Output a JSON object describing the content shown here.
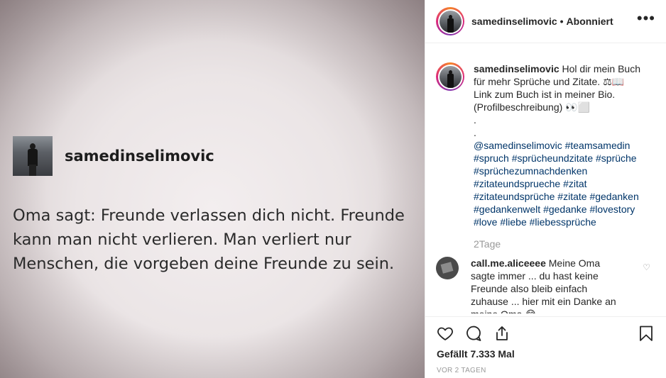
{
  "image": {
    "quote_username": "samedinselimovic",
    "quote_text": "Oma sagt: Freunde verlassen dich nicht. Freunde kann man nicht verlieren. Man verliert nur Menschen, die vorgeben deine Freunde zu sein."
  },
  "header": {
    "username": "samedinselimovic",
    "separator": "•",
    "follow_status": "Abonniert",
    "more_icon": "more-dots-icon"
  },
  "caption": {
    "username": "samedinselimovic",
    "lines": [
      "Hol dir mein Buch für mehr Sprüche und Zitate. ⚖📖",
      "Link zum Buch ist in meiner Bio.",
      "(Profilbeschreibung) 👀⬜",
      ".",
      "."
    ],
    "tags": "@samedinselimovic #teamsamedin #spruch #sprücheundzitate #sprüche #sprüchezumnachdenken #zitateundsprueche #zitat #zitateundsprüche #zitate #gedanken #gedankenwelt #gedanke #lovestory #love #liebe #liebessprüche",
    "age": "2Tage"
  },
  "comments": [
    {
      "username": "call.me.aliceeee",
      "text": "Meine Oma sagte immer ... du hast keine Freunde also bleib einfach zuhause ... hier mit ein Danke an meine Oma 😂"
    }
  ],
  "actions": {
    "icons": [
      "heart-icon",
      "comment-icon",
      "share-icon",
      "bookmark-icon"
    ],
    "likes": "Gefällt 7.333 Mal",
    "time": "VOR 2 TAGEN"
  }
}
